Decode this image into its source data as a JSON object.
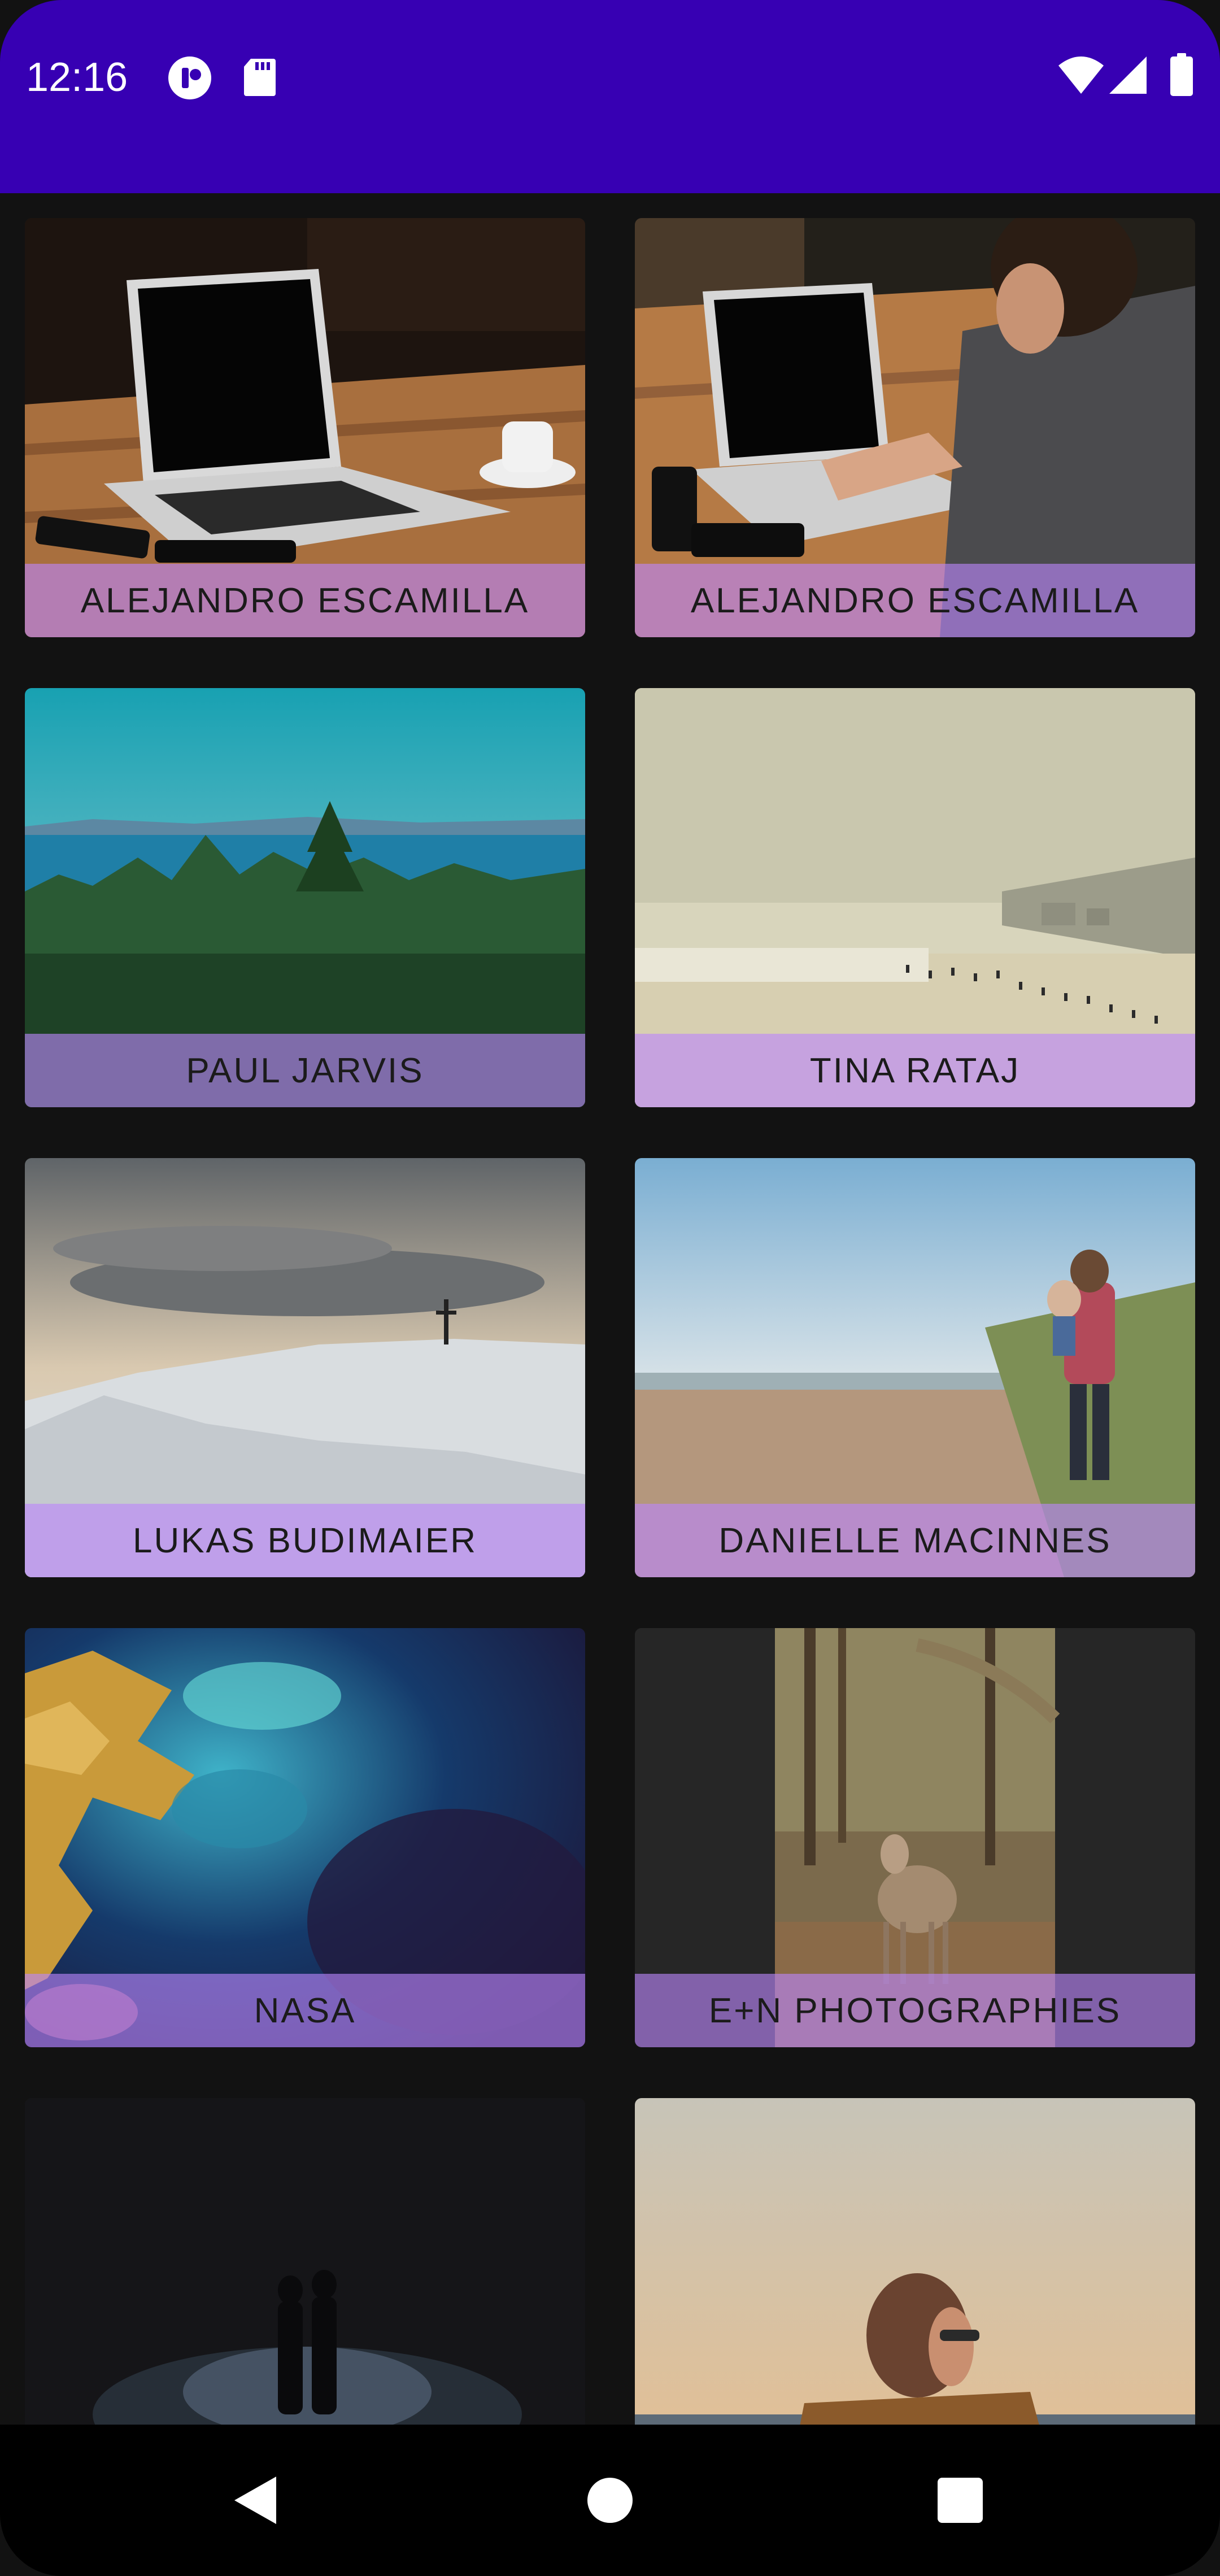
{
  "status_bar": {
    "time": "12:16",
    "icons": [
      "notification-app-icon",
      "sd-card-icon",
      "wifi-icon",
      "signal-icon",
      "battery-icon"
    ]
  },
  "gallery": {
    "items": [
      {
        "caption": "ALEJANDRO ESCAMILLA",
        "photo": "laptop-on-table"
      },
      {
        "caption": "ALEJANDRO ESCAMILLA",
        "photo": "person-typing-laptop"
      },
      {
        "caption": "PAUL JARVIS",
        "photo": "forest-sea-landscape"
      },
      {
        "caption": "TINA RATAJ",
        "photo": "beach-crowd"
      },
      {
        "caption": "LUKAS BUDIMAIER",
        "photo": "snowy-hill-cross"
      },
      {
        "caption": "DANIELLE MACINNES",
        "photo": "father-child-beach"
      },
      {
        "caption": "NASA",
        "photo": "earth-from-space"
      },
      {
        "caption": "E+N PHOTOGRAPHIES",
        "photo": "deer-in-forest"
      },
      {
        "caption": "",
        "photo": "couple-at-night"
      },
      {
        "caption": "",
        "photo": "woman-with-scarf"
      }
    ]
  },
  "nav_bar": {
    "buttons": [
      "back-icon",
      "home-icon",
      "recents-icon"
    ]
  },
  "colors": {
    "app_bar": "#3700B3",
    "background": "#121212",
    "caption_overlay": "#BB86FC"
  }
}
